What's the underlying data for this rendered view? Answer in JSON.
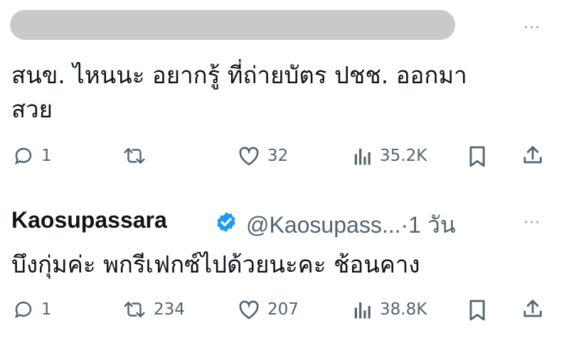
{
  "tweet1": {
    "text_line1": "สนข. ไหนนะ อยากรู้ ที่ถ่ายบัตร ปชช. ออกมา",
    "text_line2": "สวย",
    "replies": "1",
    "retweets": "",
    "likes": "32",
    "views": "35.2K"
  },
  "tweet2": {
    "author": "Kaosupassara",
    "handle_time": "@Kaosupass...·1 วัน",
    "text": "บึงกุ่มค่ะ พกรีเฟกซ์ไปด้วยนะคะ ช้อนคาง",
    "replies": "1",
    "retweets": "234",
    "likes": "207",
    "views": "38.8K"
  },
  "more_label": "···",
  "icons": {
    "reply": "reply-icon",
    "retweet": "retweet-icon",
    "like": "heart-icon",
    "views": "views-icon",
    "bookmark": "bookmark-icon",
    "share": "share-icon",
    "verified": "verified-badge-icon"
  },
  "colors": {
    "text": "#0f1419",
    "secondary": "#536471",
    "verified": "#1d9bf0",
    "redaction": "#c9c9c9"
  }
}
